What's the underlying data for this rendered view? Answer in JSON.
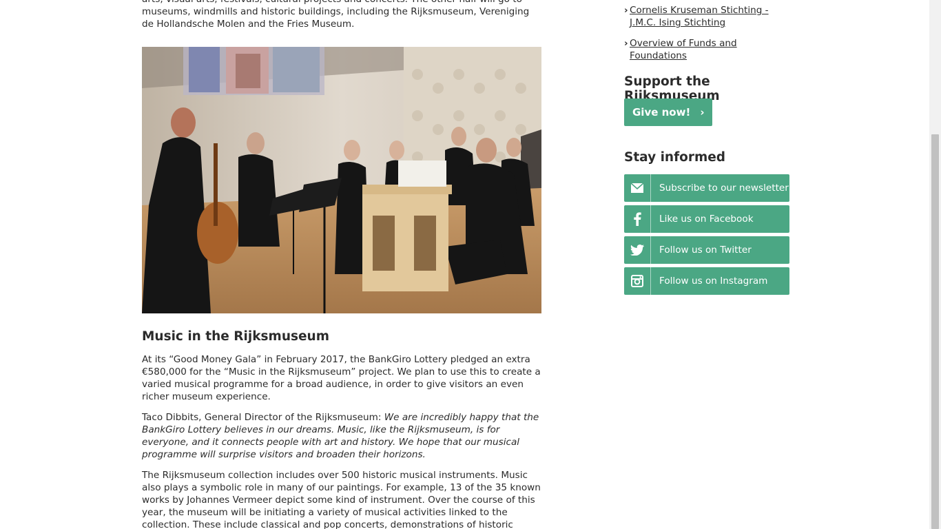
{
  "main": {
    "intro_fragment": "arts, visual arts, festivals, cultural projects and concerts. The other half will go to museums, windmills and historic buildings, including the Rijksmuseum, Vereniging de Hollandsche Molen and the Fries Museum.",
    "section_title": "Music in the Rijksmuseum",
    "para1": "At its “Good Money Gala” in February 2017, the BankGiro Lottery pledged an extra €580,000 for the “Music in the Rijksmuseum” project. We plan to use this to create a varied musical programme for a broad audience, in order to give visitors an even richer museum experience.",
    "para2_lead": "Taco Dibbits, General Director of the Rijksmuseum: ",
    "para2_quote": "We are incredibly happy that the BankGiro Lottery believes in our dreams. Music, like the Rijksmuseum, is for everyone, and it connects people with art and history. We hope that our musical programme will surprise visitors and broaden their horizons.",
    "para3": "The Rijksmuseum collection includes over 500 historic musical instruments. Music also plays a symbolic role in many of our paintings. For example, 13 of the 35 known works by Johannes Vermeer depict some kind of instrument. Over the course of this year, the museum will be initiating a variety of musical activities linked to the collection. These include classical and pop concerts, demonstrations of historic instruments, dance events, performances in the"
  },
  "sidebar": {
    "links": [
      {
        "label": "Cornelis Kruseman Stichting - J.M.C. Ising Stichting"
      },
      {
        "label": "Overview of Funds and Foundations"
      }
    ],
    "support_heading": "Support the Rijksmuseum",
    "give_label": "Give now!",
    "stay_heading": "Stay informed",
    "social": [
      {
        "label": "Subscribe to our newsletter",
        "icon": "envelope-icon"
      },
      {
        "label": "Like us on Facebook",
        "icon": "facebook-icon"
      },
      {
        "label": "Follow us on Twitter",
        "icon": "twitter-icon"
      },
      {
        "label": "Follow us on Instagram",
        "icon": "instagram-icon"
      }
    ]
  },
  "colors": {
    "accent_green": "#4ba784",
    "text": "#2b2b2b"
  }
}
